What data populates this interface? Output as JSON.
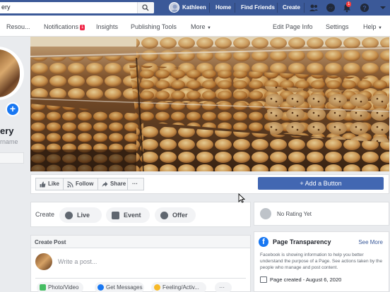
{
  "topbar": {
    "search_value": "ery",
    "user_name": "Kathleen",
    "links": [
      "Home",
      "Find Friends",
      "Create"
    ],
    "notification_badge": "1"
  },
  "pagenav": {
    "resources": "Resou...",
    "notifications": "Notifications",
    "notifications_count": "1",
    "insights": "Insights",
    "publishing_tools": "Publishing Tools",
    "more": "More",
    "edit_page_info": "Edit Page Info",
    "settings": "Settings",
    "help": "Help"
  },
  "profile": {
    "page_name": "ery",
    "username": "rname"
  },
  "actions": {
    "like": "Like",
    "follow": "Follow",
    "share": "Share",
    "more": "···",
    "add_button": "+ Add a Button"
  },
  "create": {
    "label": "Create",
    "live": "Live",
    "event": "Event",
    "offer": "Offer"
  },
  "create_post": {
    "title": "Create Post",
    "placeholder": "Write a post...",
    "buttons": [
      "Photo/Video",
      "Get Messages",
      "Feeling/Activ..."
    ],
    "more": "···"
  },
  "rating": {
    "text": "No Rating Yet"
  },
  "transparency": {
    "title": "Page Transparency",
    "see_more": "See More",
    "body": "Facebook is showing information to help you better understand the purpose of a Page. See actions taken by the people who manage and post content.",
    "created": "Page created - August 6, 2020"
  },
  "colors": {
    "facebook_blue": "#3b5998",
    "button_blue": "#4267b2",
    "badge_red": "#fa3e3e"
  }
}
